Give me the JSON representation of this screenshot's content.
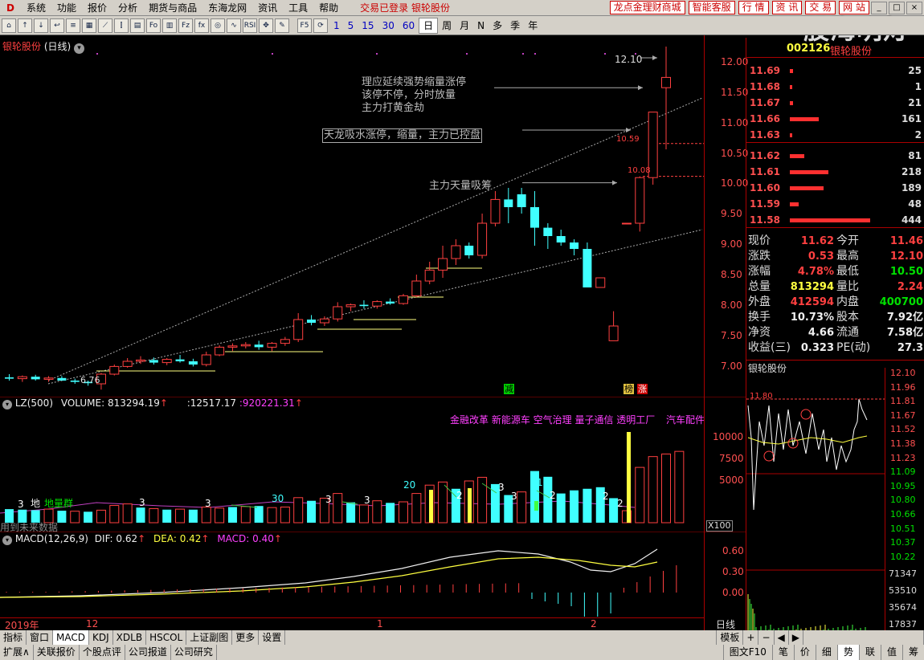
{
  "menu": {
    "logo": "D",
    "items": [
      "系统",
      "功能",
      "报价",
      "分析",
      "期货与商品",
      "东海龙网",
      "资讯",
      "工具",
      "帮助"
    ],
    "status": "交易已登录  银轮股份",
    "right_buttons": [
      "龙点金理财商城",
      "智能客服",
      "行 情",
      "资 讯",
      "交 易",
      "网 站"
    ],
    "watermark": "股海明灯"
  },
  "toolbar": {
    "periods": [
      "1",
      "5",
      "15",
      "30",
      "60"
    ],
    "cycles": [
      "日",
      "周",
      "月",
      "N",
      "多",
      "季",
      "年"
    ]
  },
  "main_chart": {
    "title": "银轮股份",
    "period": "(日线)",
    "price_ticks": [
      "12.00",
      "11.50",
      "11.00",
      "10.50",
      "10.00",
      "9.50",
      "9.00",
      "8.50",
      "8.00",
      "7.50",
      "7.00"
    ],
    "high_label": "12.10",
    "low_label": "6.76",
    "label_1059": "10.59",
    "label_1008": "10.08",
    "annotations": {
      "a1_line1": "理应延续强势缩量涨停",
      "a1_line2": "该停不停，分时放量",
      "a1_line3": "主力打黄金劫",
      "a2": "天龙吸水涨停，缩量，主力已控盘",
      "a3": "主力天量吸筹"
    },
    "marker_jian": "减",
    "marker_bang": "榜",
    "marker_zhang": "涨"
  },
  "chart_data": {
    "type": "candlestick",
    "title": "银轮股份 (日线)",
    "candles": [
      {
        "o": 6.95,
        "h": 7.0,
        "l": 6.9,
        "c": 6.93
      },
      {
        "o": 6.93,
        "h": 6.98,
        "l": 6.88,
        "c": 6.96
      },
      {
        "o": 6.96,
        "h": 6.99,
        "l": 6.9,
        "c": 6.92
      },
      {
        "o": 6.92,
        "h": 6.97,
        "l": 6.88,
        "c": 6.94
      },
      {
        "o": 6.94,
        "h": 6.97,
        "l": 6.9,
        "c": 6.9
      },
      {
        "o": 6.9,
        "h": 6.93,
        "l": 6.85,
        "c": 6.88
      },
      {
        "o": 6.88,
        "h": 6.9,
        "l": 6.82,
        "c": 6.86
      },
      {
        "o": 6.85,
        "h": 7.02,
        "l": 6.76,
        "c": 7.0
      },
      {
        "o": 7.0,
        "h": 7.15,
        "l": 6.98,
        "c": 7.12
      },
      {
        "o": 7.12,
        "h": 7.25,
        "l": 7.1,
        "c": 7.2
      },
      {
        "o": 7.2,
        "h": 7.28,
        "l": 7.16,
        "c": 7.22
      },
      {
        "o": 7.22,
        "h": 7.26,
        "l": 7.15,
        "c": 7.18
      },
      {
        "o": 7.18,
        "h": 7.25,
        "l": 7.14,
        "c": 7.23
      },
      {
        "o": 7.23,
        "h": 7.3,
        "l": 7.18,
        "c": 7.2
      },
      {
        "o": 7.2,
        "h": 7.24,
        "l": 7.12,
        "c": 7.15
      },
      {
        "o": 7.15,
        "h": 7.35,
        "l": 7.12,
        "c": 7.3
      },
      {
        "o": 7.3,
        "h": 7.45,
        "l": 7.28,
        "c": 7.42
      },
      {
        "o": 7.42,
        "h": 7.48,
        "l": 7.36,
        "c": 7.44
      },
      {
        "o": 7.44,
        "h": 7.5,
        "l": 7.4,
        "c": 7.46
      },
      {
        "o": 7.46,
        "h": 7.52,
        "l": 7.38,
        "c": 7.42
      },
      {
        "o": 7.42,
        "h": 7.5,
        "l": 7.36,
        "c": 7.48
      },
      {
        "o": 7.48,
        "h": 7.58,
        "l": 7.44,
        "c": 7.54
      },
      {
        "o": 7.54,
        "h": 7.95,
        "l": 7.5,
        "c": 7.85
      },
      {
        "o": 7.85,
        "h": 7.92,
        "l": 7.76,
        "c": 7.8
      },
      {
        "o": 7.8,
        "h": 7.9,
        "l": 7.75,
        "c": 7.86
      },
      {
        "o": 7.86,
        "h": 8.12,
        "l": 7.82,
        "c": 8.05
      },
      {
        "o": 8.05,
        "h": 8.1,
        "l": 7.98,
        "c": 8.08
      },
      {
        "o": 8.08,
        "h": 8.15,
        "l": 8.02,
        "c": 8.06
      },
      {
        "o": 8.06,
        "h": 8.15,
        "l": 8.02,
        "c": 8.13
      },
      {
        "o": 8.13,
        "h": 8.18,
        "l": 8.08,
        "c": 8.1
      },
      {
        "o": 8.1,
        "h": 8.25,
        "l": 8.08,
        "c": 8.22
      },
      {
        "o": 8.22,
        "h": 8.55,
        "l": 8.2,
        "c": 8.45
      },
      {
        "o": 8.45,
        "h": 8.75,
        "l": 8.4,
        "c": 8.62
      },
      {
        "o": 8.62,
        "h": 9.0,
        "l": 8.5,
        "c": 8.8
      },
      {
        "o": 8.8,
        "h": 9.1,
        "l": 8.7,
        "c": 9.0
      },
      {
        "o": 9.0,
        "h": 9.05,
        "l": 8.8,
        "c": 8.85
      },
      {
        "o": 8.85,
        "h": 9.5,
        "l": 8.8,
        "c": 9.35
      },
      {
        "o": 9.35,
        "h": 9.85,
        "l": 9.3,
        "c": 9.72
      },
      {
        "o": 9.72,
        "h": 9.9,
        "l": 9.35,
        "c": 9.6
      },
      {
        "o": 9.8,
        "h": 9.9,
        "l": 9.5,
        "c": 9.6
      },
      {
        "o": 9.6,
        "h": 9.85,
        "l": 9.0,
        "c": 9.28
      },
      {
        "o": 9.28,
        "h": 9.35,
        "l": 8.95,
        "c": 9.15
      },
      {
        "o": 9.15,
        "h": 9.25,
        "l": 9.0,
        "c": 9.05
      },
      {
        "o": 9.05,
        "h": 9.1,
        "l": 8.85,
        "c": 8.95
      },
      {
        "o": 8.95,
        "h": 9.05,
        "l": 8.35,
        "c": 8.35
      },
      {
        "o": 8.35,
        "h": 8.5,
        "l": 8.35,
        "c": 8.5
      },
      {
        "o": 7.52,
        "h": 7.98,
        "l": 7.52,
        "c": 7.75
      },
      {
        "o": 9.35,
        "h": 9.35,
        "l": 9.35,
        "c": 9.35
      },
      {
        "o": 9.35,
        "h": 10.08,
        "l": 9.22,
        "c": 10.06
      },
      {
        "o": 10.06,
        "h": 11.08,
        "l": 9.95,
        "c": 11.08
      },
      {
        "o": 11.46,
        "h": 12.1,
        "l": 10.5,
        "c": 11.62
      }
    ],
    "ylim": [
      6.7,
      12.2
    ]
  },
  "volume": {
    "indicator": "LZ(500)",
    "volume_label": "VOLUME: 813294.19",
    "v2": ":12517.17",
    "v3": ":920221.31",
    "concepts": "金融改革 新能源车 空气治理 量子通信 透明工厂",
    "concept2": "汽车配件",
    "ticks": [
      "10000",
      "7500",
      "5000"
    ],
    "scale": "X100",
    "label_di": "地",
    "label_diliang": "地量群",
    "hint": "用到未来数据",
    "lbl_20": "20",
    "lbl_10": "10",
    "lbl_30": "30",
    "values": [
      260,
      250,
      240,
      260,
      230,
      220,
      210,
      240,
      330,
      360,
      290,
      270,
      250,
      260,
      250,
      300,
      280,
      300,
      310,
      320,
      290,
      300,
      480,
      420,
      470,
      560,
      390,
      340,
      420,
      380,
      400,
      560,
      720,
      780,
      650,
      800,
      870,
      740,
      530,
      590,
      990,
      880,
      560,
      620,
      650,
      680,
      470,
      230,
      1060,
      7600,
      7900,
      8200
    ],
    "bar_colors": [
      "c",
      "c",
      "c",
      "r",
      "c",
      "r",
      "c",
      "r",
      "r",
      "r",
      "c",
      "r",
      "c",
      "r",
      "c",
      "r",
      "r",
      "c",
      "r",
      "c",
      "r",
      "r",
      "r",
      "c",
      "r",
      "r",
      "c",
      "r",
      "r",
      "c",
      "r",
      "r",
      "r",
      "r",
      "c",
      "r",
      "r",
      "c",
      "c",
      "r",
      "c",
      "c",
      "c",
      "c",
      "c",
      "c",
      "c",
      "r",
      "r",
      "r",
      "r",
      "r"
    ]
  },
  "macd": {
    "label": "MACD(12,26,9)",
    "dif": "DIF: 0.62",
    "dea": "DEA: 0.42",
    "macd": "MACD: 0.40",
    "ticks": [
      "0.60",
      "0.30",
      "0.00"
    ],
    "date_2019": "2019年",
    "date_12": "12",
    "date_1": "1",
    "date_2": "2",
    "period_tag": "日线"
  },
  "quote": {
    "code": "002126",
    "name": "银轮股份",
    "asks": [
      {
        "price": "11.69",
        "vol": "25",
        "bar": 4
      },
      {
        "price": "11.68",
        "vol": "1",
        "bar": 3
      },
      {
        "price": "11.67",
        "vol": "21",
        "bar": 4
      },
      {
        "price": "11.66",
        "vol": "161",
        "bar": 36
      },
      {
        "price": "11.63",
        "vol": "2",
        "bar": 3
      }
    ],
    "bids": [
      {
        "price": "11.62",
        "vol": "81",
        "bar": 18
      },
      {
        "price": "11.61",
        "vol": "218",
        "bar": 48
      },
      {
        "price": "11.60",
        "vol": "189",
        "bar": 42
      },
      {
        "price": "11.59",
        "vol": "48",
        "bar": 11
      },
      {
        "price": "11.58",
        "vol": "444",
        "bar": 100
      }
    ],
    "stats": [
      {
        "l1": "现价",
        "v1": "11.62",
        "c1": "red",
        "l2": "今开",
        "v2": "11.46",
        "c2": "red"
      },
      {
        "l1": "涨跌",
        "v1": "0.53",
        "c1": "red",
        "l2": "最高",
        "v2": "12.10",
        "c2": "red"
      },
      {
        "l1": "涨幅",
        "v1": "4.78%",
        "c1": "red",
        "l2": "最低",
        "v2": "10.50",
        "c2": "green"
      },
      {
        "l1": "总量",
        "v1": "813294",
        "c1": "yellow",
        "l2": "量比",
        "v2": "2.24",
        "c2": "red"
      },
      {
        "l1": "外盘",
        "v1": "412594",
        "c1": "red",
        "l2": "内盘",
        "v2": "400700",
        "c2": "green"
      },
      {
        "l1": "换手",
        "v1": "10.73%",
        "c1": "white",
        "l2": "股本",
        "v2": "7.92亿",
        "c2": "white"
      },
      {
        "l1": "净资",
        "v1": "4.66",
        "c1": "white",
        "l2": "流通",
        "v2": "7.58亿",
        "c2": "white"
      },
      {
        "l1": "收益(三)",
        "v1": "0.323",
        "c1": "white",
        "l2": "PE(动)",
        "v2": "27.3",
        "c2": "white"
      }
    ]
  },
  "mini_chart": {
    "title": "银轮股份",
    "label_1180": "11.80",
    "price_ticks": [
      "12.10",
      "11.96",
      "11.81",
      "11.67",
      "11.52",
      "11.38",
      "11.23",
      "11.09",
      "10.95",
      "10.80",
      "10.66",
      "10.51",
      "10.37",
      "10.22"
    ],
    "vol_ticks": [
      "71347",
      "53510",
      "35674",
      "17837"
    ]
  },
  "tabs_row1": [
    "指标",
    "窗口",
    "MACD",
    "KDJ",
    "XDLB",
    "HSCOL",
    "上证副图",
    "更多",
    "设置"
  ],
  "tabs_row1_right": "模板",
  "tabs_row2": [
    "扩展∧",
    "关联报价",
    "个股点评",
    "公司报道",
    "公司研究"
  ],
  "tabs_row2_right": [
    "图文F10",
    "笔",
    "价",
    "细",
    "势",
    "联",
    "值",
    "筹"
  ]
}
